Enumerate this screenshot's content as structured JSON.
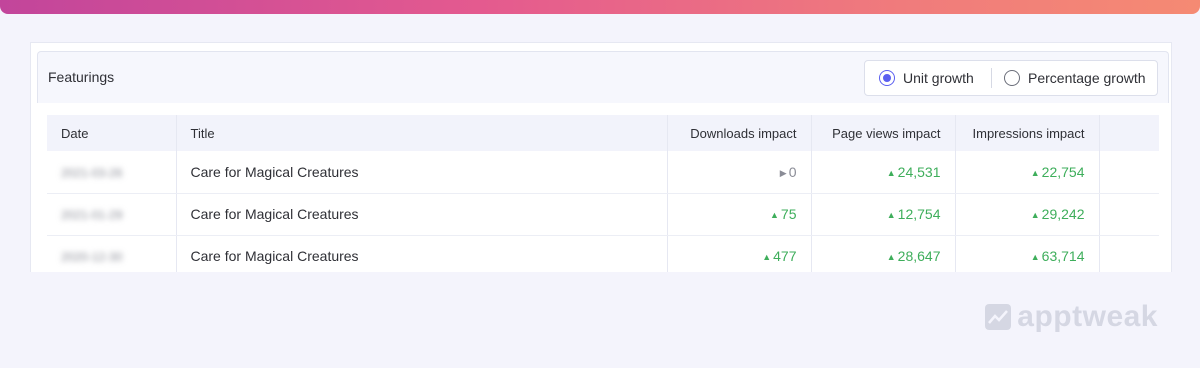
{
  "panel": {
    "title": "Featurings",
    "toggle": {
      "options": [
        {
          "label": "Unit growth",
          "selected": true
        },
        {
          "label": "Percentage growth",
          "selected": false
        }
      ]
    }
  },
  "table": {
    "columns": [
      "Date",
      "Title",
      "Downloads impact",
      "Page views impact",
      "Impressions impact",
      ""
    ],
    "rows": [
      {
        "date": "2021-03-26",
        "title": "Care for Magical Creatures",
        "downloads": "0",
        "downloads_trend": "flat",
        "page_views": "24,531",
        "impressions": "22,754"
      },
      {
        "date": "2021-01-29",
        "title": "Care for Magical Creatures",
        "downloads": "75",
        "downloads_trend": "up",
        "page_views": "12,754",
        "impressions": "29,242"
      },
      {
        "date": "2020-12-30",
        "title": "Care for Magical Creatures",
        "downloads": "477",
        "downloads_trend": "up",
        "page_views": "28,647",
        "impressions": "63,714"
      }
    ]
  },
  "colors": {
    "accent": "#5b5ff0",
    "positive": "#3eae5b",
    "neutral": "#8a8c96",
    "gradient_start": "#c2459b",
    "gradient_end": "#f58a73"
  },
  "icons": {
    "up": "triangle-up-icon",
    "flat": "triangle-right-icon",
    "brand": "apptweak-logo-icon"
  },
  "brand": {
    "text": "apptweak"
  }
}
